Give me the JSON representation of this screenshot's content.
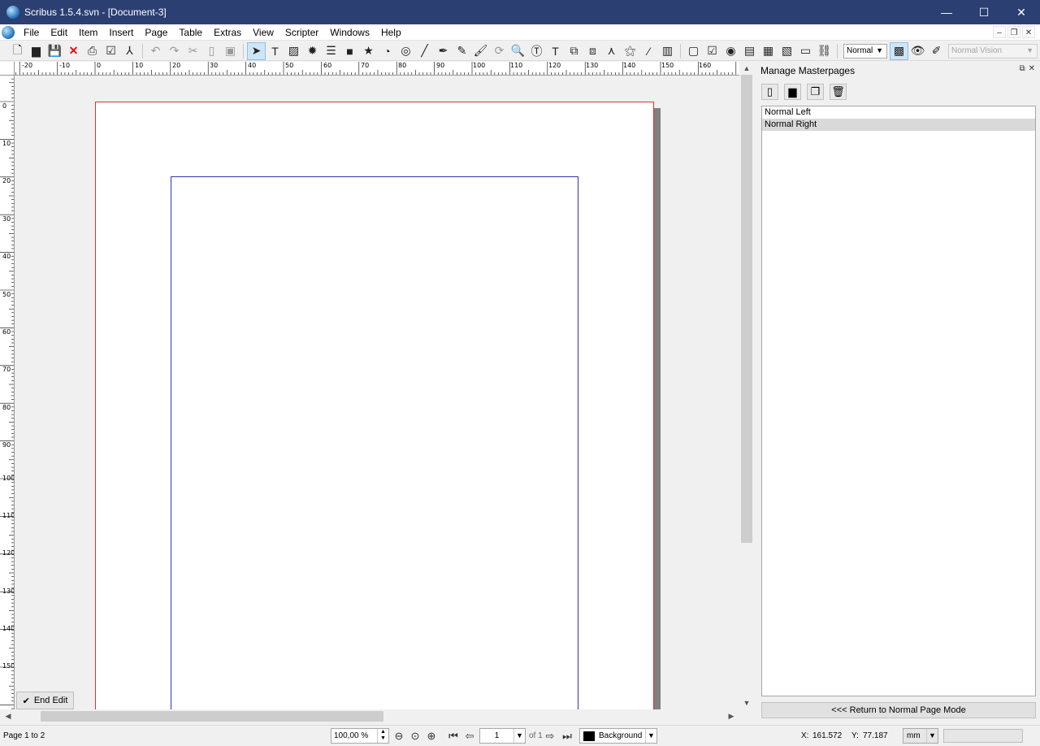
{
  "window": {
    "title": "Scribus 1.5.4.svn - [Document-3]",
    "minimize": "—",
    "maximize": "☐",
    "close": "✕"
  },
  "menu": {
    "items": [
      "File",
      "Edit",
      "Item",
      "Insert",
      "Page",
      "Table",
      "Extras",
      "View",
      "Scripter",
      "Windows",
      "Help"
    ]
  },
  "toolbar": {
    "mode_value": "Normal",
    "vision_value": "Normal Vision"
  },
  "rulers": {
    "horizontal": [
      "-20",
      "-10",
      "0",
      "10",
      "20",
      "30",
      "40",
      "50",
      "60",
      "70",
      "80",
      "90",
      "100",
      "110",
      "120",
      "130",
      "140",
      "150",
      "160"
    ],
    "vertical": [
      "0",
      "10",
      "20",
      "30",
      "40",
      "50",
      "60",
      "70",
      "80",
      "90",
      "100",
      "110",
      "120",
      "130",
      "140",
      "150"
    ]
  },
  "canvas": {
    "end_edit_label": "End Edit"
  },
  "masterpages": {
    "title": "Manage Masterpages",
    "items": [
      {
        "label": "Normal Left",
        "selected": false
      },
      {
        "label": "Normal Right",
        "selected": true
      }
    ],
    "return_label": "<<< Return to Normal Page Mode"
  },
  "status": {
    "page_count": "Page 1 to 2",
    "zoom": "100,00 %",
    "page_number": "1",
    "page_of": "of 1",
    "layer": "Background",
    "x_label": "X:",
    "x_value": "161.572",
    "y_label": "Y:",
    "y_value": "77.187",
    "unit": "mm"
  },
  "colors": {
    "titlebar": "#2b3f73",
    "page_border": "#e03030",
    "margin_guide": "#3333b0"
  }
}
